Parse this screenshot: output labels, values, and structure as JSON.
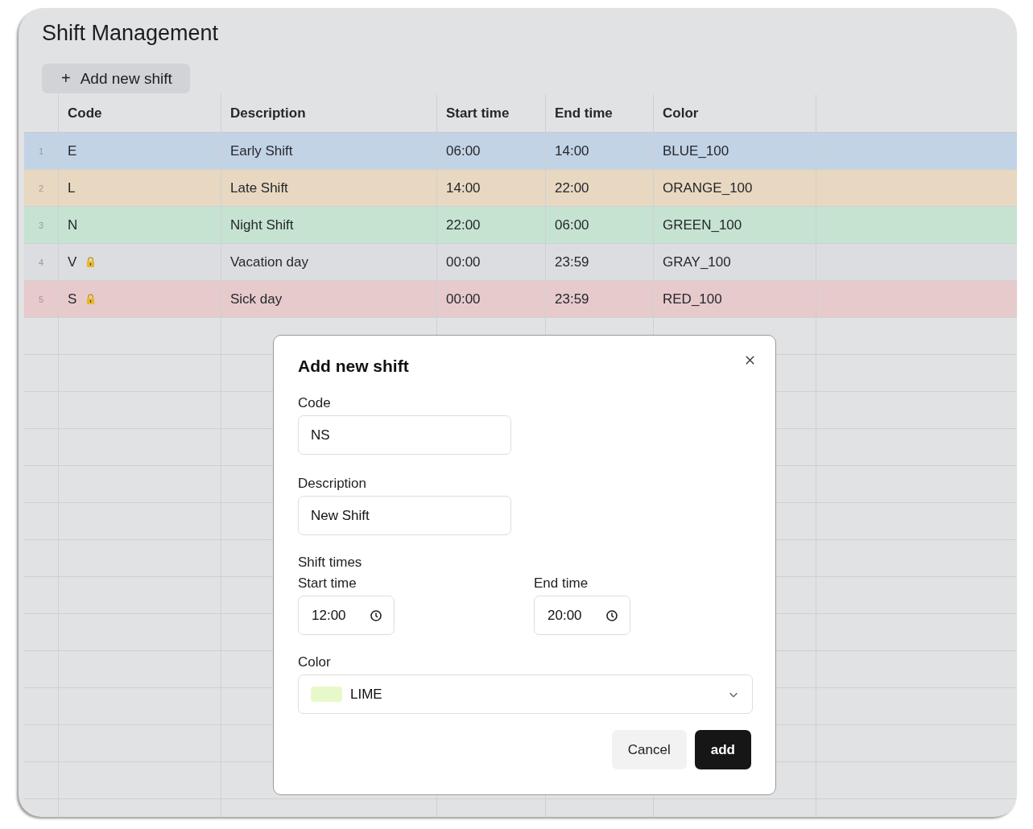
{
  "page": {
    "title": "Shift Management"
  },
  "toolbar": {
    "add_button": {
      "icon": "+",
      "label": "Add new shift"
    }
  },
  "table": {
    "columns": [
      "Code",
      "Description",
      "Start time",
      "End time",
      "Color"
    ],
    "rows": [
      {
        "number": "1",
        "code": "E",
        "locked": false,
        "description": "Early Shift",
        "start": "06:00",
        "end": "14:00",
        "color_name": "BLUE_100",
        "color": "#c3d3e6"
      },
      {
        "number": "2",
        "code": "L",
        "locked": false,
        "description": "Late Shift",
        "start": "14:00",
        "end": "22:00",
        "color_name": "ORANGE_100",
        "color": "#e8d8c1"
      },
      {
        "number": "3",
        "code": "N",
        "locked": false,
        "description": "Night Shift",
        "start": "22:00",
        "end": "06:00",
        "color_name": "GREEN_100",
        "color": "#c6e3d2"
      },
      {
        "number": "4",
        "code": "V",
        "locked": true,
        "description": "Vacation day",
        "start": "00:00",
        "end": "23:59",
        "color_name": "GRAY_100",
        "color": "#dcdde0"
      },
      {
        "number": "5",
        "code": "S",
        "locked": true,
        "description": "Sick day",
        "start": "00:00",
        "end": "23:59",
        "color_name": "RED_100",
        "color": "#e6cacc"
      }
    ]
  },
  "dialog": {
    "title": "Add new shift",
    "code": {
      "label": "Code",
      "value": "NS"
    },
    "description": {
      "label": "Description",
      "value": "New Shift"
    },
    "times_heading": "Shift times",
    "start_time": {
      "label": "Start time",
      "value": "12:00"
    },
    "end_time": {
      "label": "End time",
      "value": "20:00"
    },
    "color": {
      "label": "Color",
      "value": "LIME",
      "color": "#e7f9c9"
    },
    "buttons": [
      {
        "kind": "secondary",
        "label": "Cancel"
      },
      {
        "kind": "primary",
        "label": "add"
      }
    ]
  }
}
